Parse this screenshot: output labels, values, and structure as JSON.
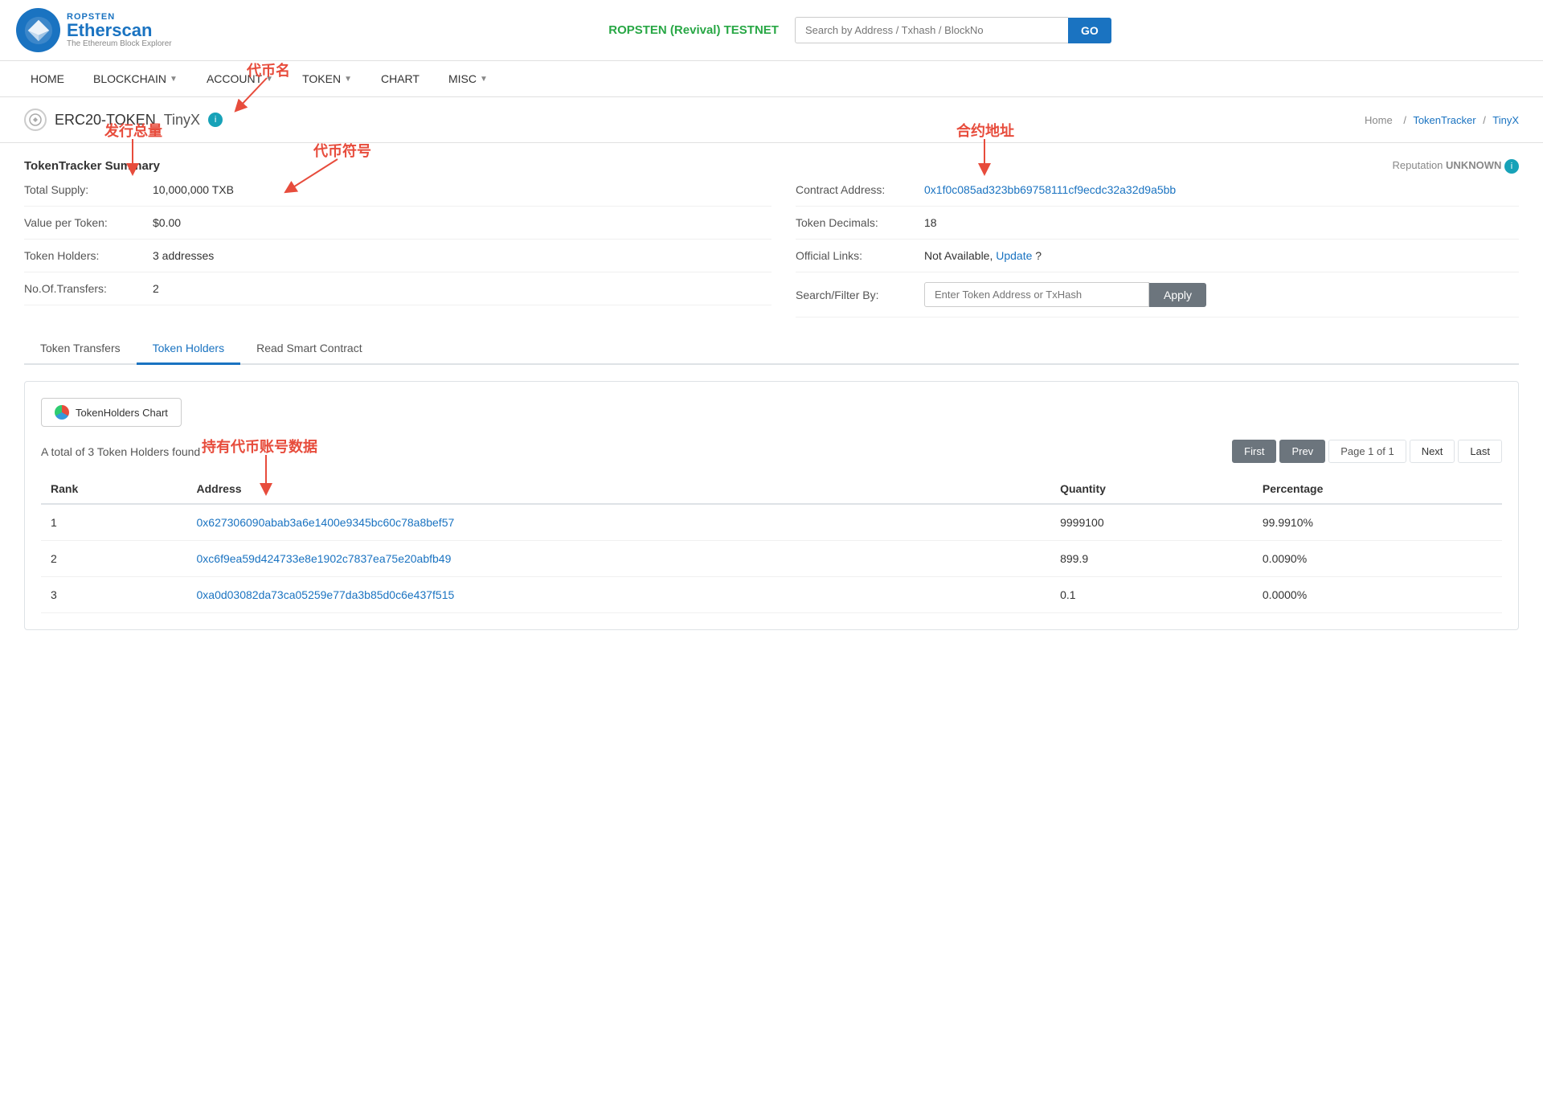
{
  "header": {
    "logo": {
      "ropsten": "ROPSTEN",
      "etherscan": "Etherscan",
      "subtitle": "The Ethereum Block Explorer"
    },
    "testnet_label": "ROPSTEN (Revival) TESTNET",
    "search_placeholder": "Search by Address / Txhash / BlockNo",
    "search_btn": "GO"
  },
  "nav": {
    "items": [
      {
        "label": "HOME",
        "has_arrow": false
      },
      {
        "label": "BLOCKCHAIN",
        "has_arrow": true
      },
      {
        "label": "ACCOUNT",
        "has_arrow": true
      },
      {
        "label": "TOKEN",
        "has_arrow": true
      },
      {
        "label": "CHART",
        "has_arrow": false
      },
      {
        "label": "MISC",
        "has_arrow": true
      }
    ]
  },
  "page_header": {
    "token_type": "ERC20-TOKEN",
    "token_name": "TinyX",
    "breadcrumb": {
      "home": "Home",
      "sep1": "/",
      "tracker": "TokenTracker",
      "sep2": "/",
      "current": "TinyX"
    }
  },
  "summary": {
    "title": "TokenTracker Summary",
    "reputation_label": "Reputation",
    "reputation_value": "UNKNOWN",
    "total_supply_label": "Total Supply:",
    "total_supply_value": "10,000,000 TXB",
    "contract_address_label": "Contract Address:",
    "contract_address_value": "0x1f0c085ad323bb69758111cf9ecdc32a32d9a5bb",
    "value_per_token_label": "Value per Token:",
    "value_per_token_value": "$0.00",
    "token_decimals_label": "Token Decimals:",
    "token_decimals_value": "18",
    "token_holders_label": "Token Holders:",
    "token_holders_value": "3 addresses",
    "official_links_label": "Official Links:",
    "official_links_value": "Not Available,",
    "official_links_update": "Update",
    "official_links_q": "?",
    "no_transfers_label": "No.Of.Transfers:",
    "no_transfers_value": "2",
    "search_filter_label": "Search/Filter By:",
    "filter_placeholder": "Enter Token Address or TxHash",
    "apply_btn": "Apply"
  },
  "tabs": [
    {
      "label": "Token Transfers",
      "active": false
    },
    {
      "label": "Token Holders",
      "active": true
    },
    {
      "label": "Read Smart Contract",
      "active": false
    }
  ],
  "chart_section": {
    "chart_btn_label": "TokenHolders Chart",
    "total_text": "A total of 3 Token Holders found",
    "pagination": {
      "first": "First",
      "prev": "Prev",
      "page_text": "Page 1 of 1",
      "next": "Next",
      "last": "Last"
    }
  },
  "table": {
    "columns": [
      "Rank",
      "Address",
      "Quantity",
      "Percentage"
    ],
    "rows": [
      {
        "rank": "1",
        "address": "0x627306090abab3a6e1400e9345bc60c78a8bef57",
        "quantity": "9999100",
        "percentage": "99.9910%"
      },
      {
        "rank": "2",
        "address": "0xc6f9ea59d424733e8e1902c7837ea75e20abfb49",
        "quantity": "899.9",
        "percentage": "0.0090%"
      },
      {
        "rank": "3",
        "address": "0xa0d03082da73ca05259e77da3b85d0c6e437f515",
        "quantity": "0.1",
        "percentage": "0.0000%"
      }
    ]
  },
  "annotations": {
    "token_name_label": "代币名",
    "total_supply_label": "发行总量",
    "token_symbol_label": "代币符号",
    "contract_address_label": "合约地址",
    "holders_data_label": "持有代币账号数据"
  }
}
